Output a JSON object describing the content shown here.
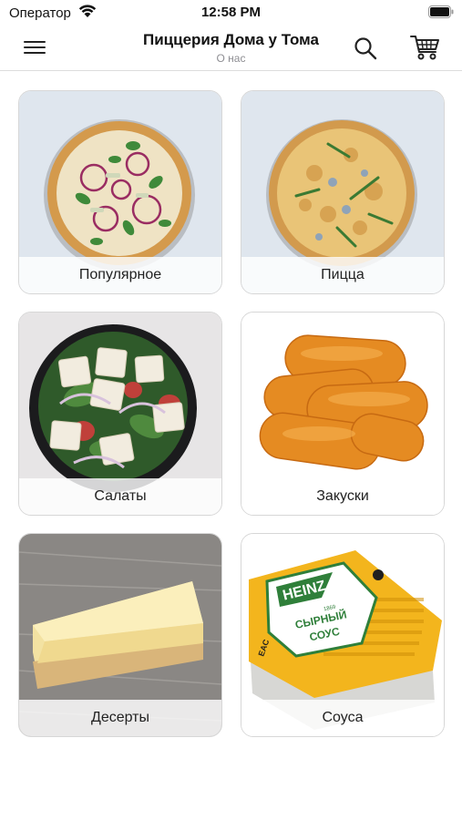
{
  "status_bar": {
    "carrier": "Оператор",
    "time": "12:58 PM"
  },
  "nav": {
    "title": "Пиццерия Дома у Тома",
    "subtitle": "О нас",
    "icons": [
      "menu-icon",
      "search-icon",
      "cart-icon"
    ]
  },
  "categories": [
    {
      "label": "Популярное",
      "image": "pizza-icon"
    },
    {
      "label": "Пицца",
      "image": "pizza-icon"
    },
    {
      "label": "Салаты",
      "image": "salad-icon"
    },
    {
      "label": "Закуски",
      "image": "nuggets-icon"
    },
    {
      "label": "Десерты",
      "image": "cheesecake-icon"
    },
    {
      "label": "Соуса",
      "image": "sauce-icon"
    }
  ],
  "sauce_pack": {
    "brand": "HEINZ",
    "year": "1869",
    "line1": "СЫРНЫЙ",
    "line2": "СОУС",
    "mark": "EAC"
  },
  "colors": {
    "accent": "#222222",
    "subtitle": "#8e8e93",
    "card_border": "#d7d7d7"
  }
}
